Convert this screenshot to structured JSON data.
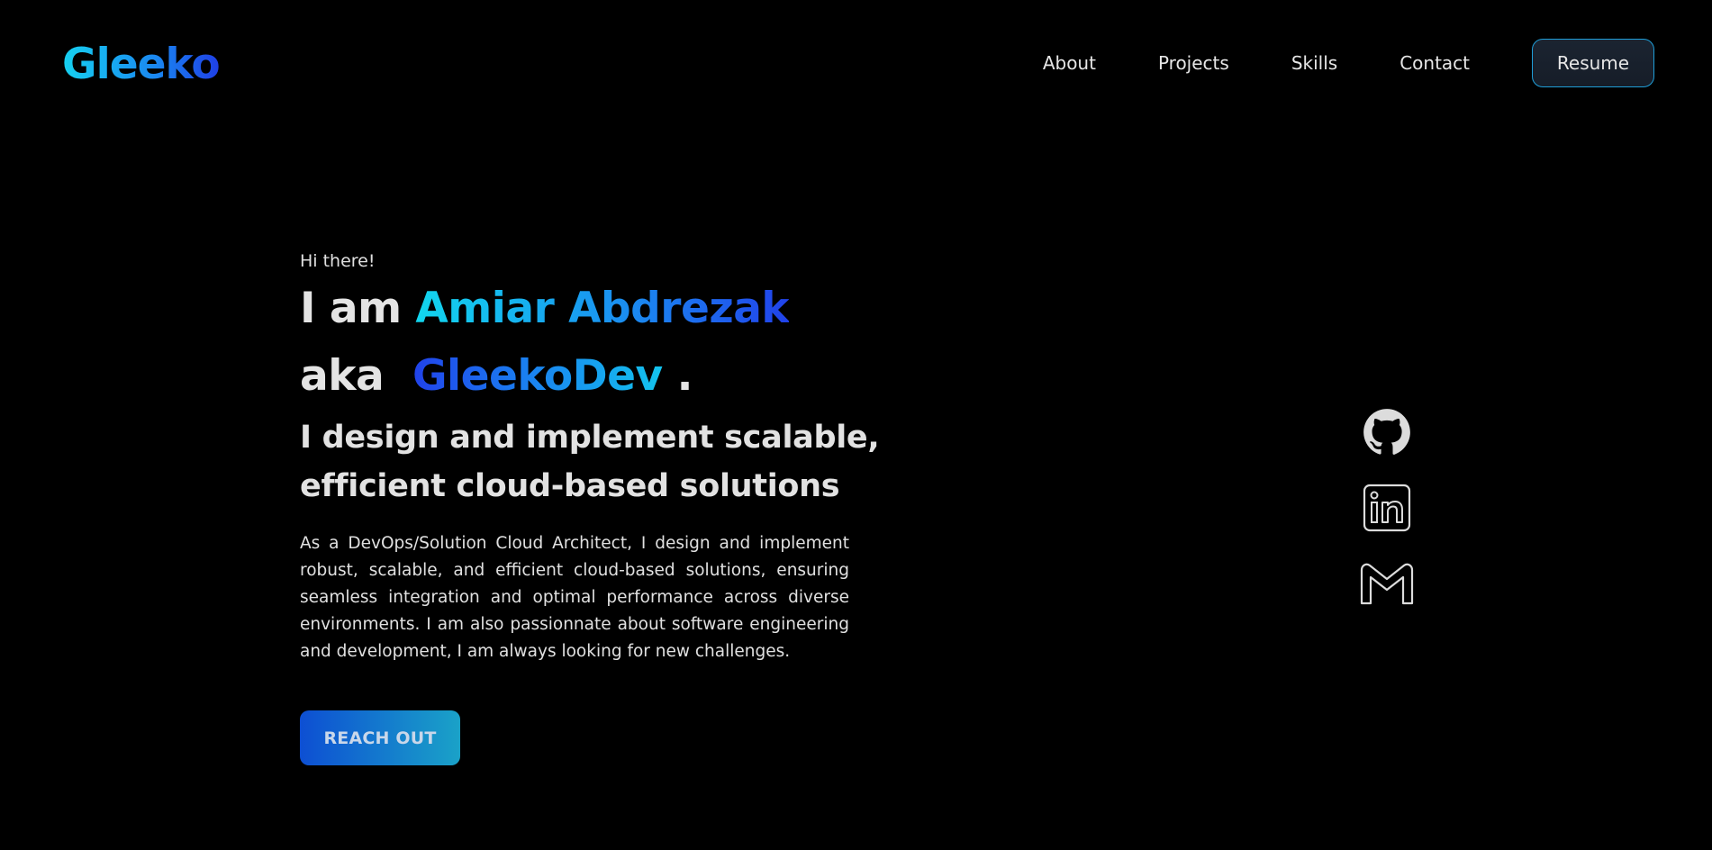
{
  "header": {
    "logo": "Gleeko",
    "nav": [
      "About",
      "Projects",
      "Skills",
      "Contact"
    ],
    "resume_label": "Resume"
  },
  "hero": {
    "greeting": "Hi there!",
    "intro_prefix": "I am ",
    "name": "Amiar Abdrezak",
    "aka_prefix": "aka ",
    "alias": "GleekoDev",
    "alias_suffix": " .",
    "tagline": "I design and implement scalable, efficient cloud-based solutions",
    "bio": "As a DevOps/Solution Cloud Architect, I design and implement robust, scalable, and efficient cloud-based solutions, ensuring seamless integration and optimal performance across diverse environments. I am also passionnate about software engineering and development, I am always looking for new challenges.",
    "cta_label": "REACH OUT"
  },
  "socials": [
    {
      "icon": "github-icon"
    },
    {
      "icon": "linkedin-icon"
    },
    {
      "icon": "gmail-icon"
    }
  ],
  "colors": {
    "background": "#000000",
    "accent_cyan": "#16d1f0",
    "accent_blue": "#1f3fe6",
    "text": "#e4e4e4"
  }
}
